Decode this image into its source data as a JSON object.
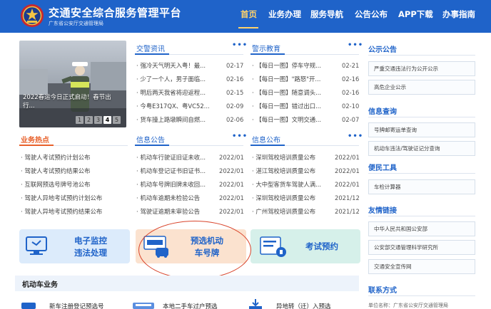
{
  "header": {
    "title": "交通安全综合服务管理平台",
    "subtitle": "广东省公安厅交通管理局",
    "nav": [
      "首页",
      "业务办理",
      "服务导航",
      "公告公布",
      "APP下载",
      "办事指南"
    ],
    "active_index": 0
  },
  "carousel": {
    "caption": "2022春运今日正式启动！春节出行...",
    "dots": [
      "1",
      "2",
      "3",
      "4",
      "5"
    ],
    "active_dot": 3
  },
  "blocks": {
    "traffic_news": {
      "title": "交警资讯",
      "more": "•••",
      "items": [
        {
          "text": "强冷天气明天入粤！最...",
          "date": "02-17"
        },
        {
          "text": "少了一个人，男子面临...",
          "date": "02-16"
        },
        {
          "text": "明后两天我省将迎返程...",
          "date": "02-15"
        },
        {
          "text": "今粤E317QX、粤VC52...",
          "date": "02-09"
        },
        {
          "text": "货车撞上路墩瞬间自燃...",
          "date": "02-06"
        }
      ]
    },
    "warning_edu": {
      "title": "警示教育",
      "more": "•••",
      "items": [
        {
          "text": "【每日一图】停车守规...",
          "date": "02-21"
        },
        {
          "text": "【每日一图】\"路怒\"开...",
          "date": "02-16"
        },
        {
          "text": "【每日一图】随意调头...",
          "date": "02-16"
        },
        {
          "text": "【每日一图】错过出口...",
          "date": "02-10"
        },
        {
          "text": "【每日一图】文明交通...",
          "date": "02-07"
        }
      ]
    },
    "hot_business": {
      "title": "业务热点",
      "items": [
        {
          "text": "驾驶人考试预约计划公布"
        },
        {
          "text": "驾驶人考试预约结果公布"
        },
        {
          "text": "互联网预选号牌号池公布"
        },
        {
          "text": "驾驶人异地考试预约计划公布"
        },
        {
          "text": "驾驶人异地考试预约结果公布"
        }
      ]
    },
    "info_notice": {
      "title": "信息公告",
      "more": "•••",
      "items": [
        {
          "text": "机动车行驶证旧证未收...",
          "date": "2022/01"
        },
        {
          "text": "机动车登记证书旧证书...",
          "date": "2022/01"
        },
        {
          "text": "机动车号牌旧牌未收回...",
          "date": "2022/01"
        },
        {
          "text": "机动车逾期未检验公告",
          "date": "2022/01"
        },
        {
          "text": "驾驶证逾期未审验公告",
          "date": "2022/01"
        }
      ]
    },
    "info_publish": {
      "title": "信息公布",
      "more": "•••",
      "items": [
        {
          "text": "深圳驾校培训质量公布",
          "date": "2022/01"
        },
        {
          "text": "湛江驾校培训质量公布",
          "date": "2022/01"
        },
        {
          "text": "大中型客货车驾驶人满...",
          "date": "2022/01"
        },
        {
          "text": "深圳驾校培训质量公布",
          "date": "2021/12"
        },
        {
          "text": "广州驾校培训质量公布",
          "date": "2021/12"
        }
      ]
    }
  },
  "sidebar": {
    "public_notice": {
      "title": "公示公告",
      "items": [
        "严重交通违法行为公开公示",
        "高危企业公示"
      ]
    },
    "info_query": {
      "title": "信息查询",
      "items": [
        "号牌邮寄运单查询",
        "机动车违法/驾驶证记分查询"
      ]
    },
    "tools": {
      "title": "便民工具",
      "items": [
        "车检计算器"
      ]
    },
    "links": {
      "title": "友情链接",
      "items": [
        "中华人民共和国公安部",
        "公安部交通管理科学研究所",
        "交通安全宣传网"
      ]
    },
    "contact": {
      "title": "联系方式",
      "text": "单位名称：广东省公安厅交通管理局"
    }
  },
  "cards": {
    "monitor": [
      "电子监控",
      "违法处理"
    ],
    "plate": [
      "预选机动",
      "车号牌"
    ],
    "exam": "考试预约"
  },
  "motor": {
    "title": "机动车业务",
    "items": [
      "新车注册登记预选号",
      "本地二手车过户预选",
      "异地转（迁）入预选"
    ]
  },
  "colors": {
    "brand": "#1f63c9",
    "accent": "#e8612b",
    "active_nav": "#ffd36b",
    "annotation": "#d9442b"
  }
}
